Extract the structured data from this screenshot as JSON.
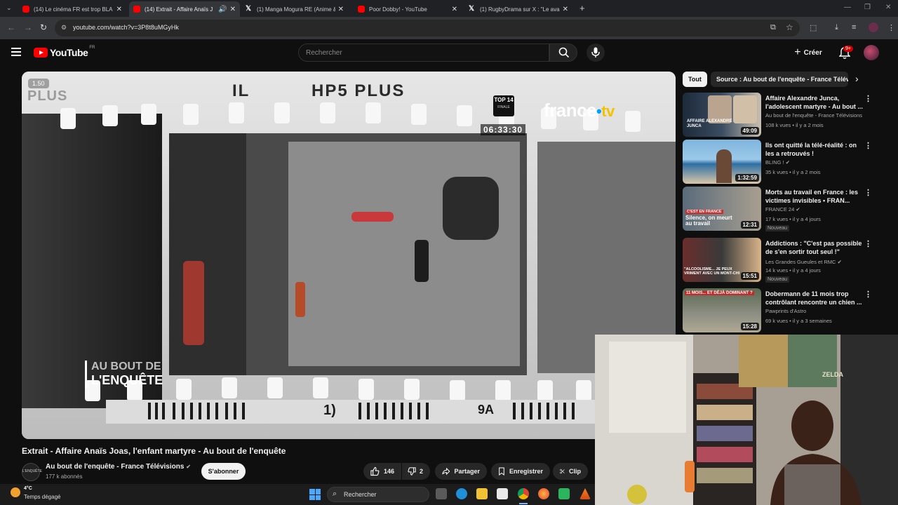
{
  "browser": {
    "tabs": [
      {
        "title": "(14) Le cinéma FR est trop BLA",
        "favicon": "youtube-icon",
        "active": false
      },
      {
        "title": "(14) Extrait - Affaire Anaïs J",
        "favicon": "youtube-icon",
        "active": true
      },
      {
        "title": "(1) Manga Mogura RE (Anime &",
        "favicon": "x-icon",
        "active": false
      },
      {
        "title": "Poor Dobby! - YouTube",
        "favicon": "youtube-icon",
        "active": false
      },
      {
        "title": "(1) RugbyDrama sur X : \"Le ava",
        "favicon": "x-icon",
        "active": false
      }
    ],
    "url": "youtube.com/watch?v=3P8t8uMGyHk"
  },
  "youtube": {
    "logo_text": "YouTube",
    "country_code": "FR",
    "search_placeholder": "Rechercher",
    "create_label": "Créer",
    "notif_badge": "9+"
  },
  "video": {
    "speed_label": "1.50",
    "overlay": {
      "film_text_1": "IL",
      "film_text_2": "HP5 PLUS",
      "film_text_3": "PLUS",
      "score_logo": "TOP 14",
      "score_sub": "FINALE",
      "timer": "06:33:30",
      "channel_logo": "france",
      "watermark_1": "AU BOUT DE",
      "watermark_2": "L'ENQUÊTE",
      "film_code_1": "1)",
      "film_code_2": "9A"
    },
    "title": "Extrait - Affaire Anaïs Joas, l'enfant martyre - Au bout de l'enquête",
    "channel_avatar_text": "L'ENQUÊTE",
    "channel_name": "Au bout de l'enquête - France Télévisions",
    "subscribers": "177 k abonnés",
    "subscribe_label": "S'abonner",
    "likes": "146",
    "dislikes": "2",
    "share_label": "Partager",
    "save_label": "Enregistrer",
    "clip_label": "Clip"
  },
  "sidebar": {
    "chips": [
      "Tout",
      "Source : Au bout de l'enquête - France Télévisions"
    ],
    "recommendations": [
      {
        "title": "Affaire Alexandre Junca, l'adolescent martyre - Au bout ...",
        "channel": "Au bout de l'enquête - France Télévisions",
        "meta": "108 k vues • il y a 2 mois",
        "duration": "49:09",
        "thumb_text": "AFFAIRE ALEXANDRE JUNCA",
        "new": ""
      },
      {
        "title": "Ils ont quitté la télé-réalité : on les a retrouvés !",
        "channel": "BLING !",
        "meta": "35 k vues • il y a 2 mois",
        "duration": "1:32:59",
        "thumb_text": "",
        "new": ""
      },
      {
        "title": "Morts au travail en France : les victimes invisibles • FRAN...",
        "channel": "FRANCE 24",
        "meta": "17 k vues • il y a 4 jours",
        "duration": "12:31",
        "thumb_text": "Silence, on meurt au travail",
        "thumb_tag": "C'EST EN FRANCE",
        "new": "Nouveau"
      },
      {
        "title": "Addictions : \"C'est pas possible de s'en sortir tout seul !\"",
        "channel": "Les Grandes Gueules et RMC",
        "meta": "14 k vues • il y a 4 jours",
        "duration": "15:51",
        "thumb_text": "\"ALCOOLISME... JE PEUX VRIMENT AVEC UN MONT-CHI",
        "new": "Nouveau"
      },
      {
        "title": "Dobermann de 11 mois trop contrôlant rencontre un chien ...",
        "channel": "Pawprints d'Astro",
        "meta": "69 k vues • il y a 3 semaines",
        "duration": "15:28",
        "thumb_text": "11 MOIS... ET DÉJÀ DOMINANT ?",
        "new": ""
      }
    ]
  },
  "webcam": {
    "poster_text": "ZELDA"
  },
  "taskbar": {
    "temperature": "4°C",
    "weather": "Temps dégagé",
    "search_label": "Rechercher"
  },
  "colors": {
    "youtube_red": "#ff0000",
    "background": "#0f0f0f",
    "chip_active": "#f1f1f1",
    "france_tv_accent": "#00a2ff"
  }
}
